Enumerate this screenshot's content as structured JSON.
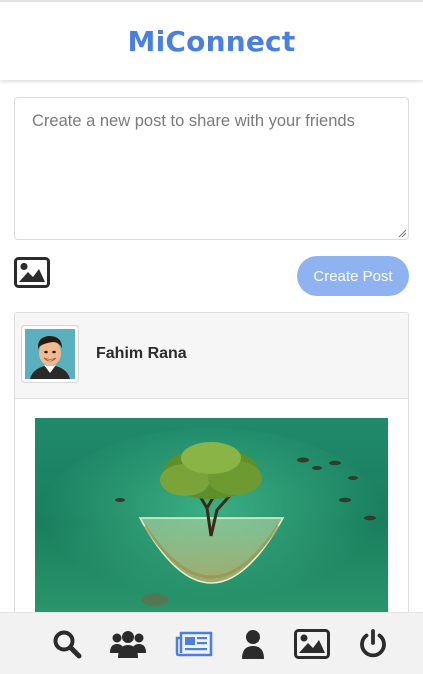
{
  "header": {
    "brand": "MiConnect"
  },
  "composer": {
    "placeholder": "Create a new post to share with your friends",
    "image_icon": "image-icon",
    "submit_label": "Create Post"
  },
  "feed": {
    "posts": [
      {
        "author": "Fahim Rana",
        "avatar_icon": "avatar",
        "image": "underwater-tree-bubble"
      }
    ]
  },
  "nav": {
    "items": [
      {
        "icon": "search-icon",
        "active": false
      },
      {
        "icon": "users-icon",
        "active": false
      },
      {
        "icon": "newspaper-icon",
        "active": true
      },
      {
        "icon": "user-icon",
        "active": false
      },
      {
        "icon": "image-icon",
        "active": false
      },
      {
        "icon": "power-icon",
        "active": false
      }
    ]
  },
  "colors": {
    "brand": "#4a7fe0",
    "button": "#8fb3f1",
    "nav_active": "#4a7fe0",
    "nav_icon": "#2b2b2b"
  }
}
